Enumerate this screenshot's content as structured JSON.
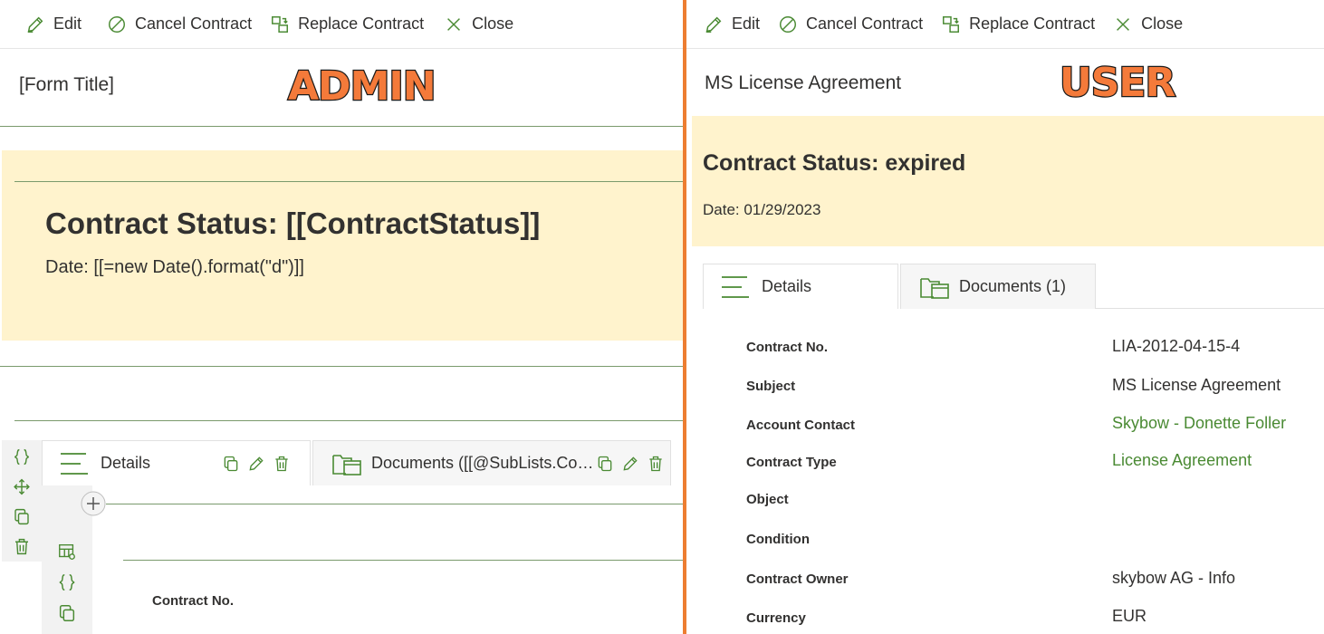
{
  "toolbar": {
    "edit_label": "Edit",
    "cancel_label": "Cancel Contract",
    "replace_label": "Replace Contract",
    "close_label": "Close"
  },
  "admin": {
    "badge": "ADMIN",
    "form_title": "[Form Title]",
    "status_title": "Contract Status: [[ContractStatus]]",
    "status_date": "Date: [[=new Date().format(\"d\")]]",
    "tabs": [
      {
        "label": "Details"
      },
      {
        "label": "Documents ([[@SubLists.Contract Documents]])"
      }
    ],
    "field_label": "Contract No."
  },
  "user": {
    "badge": "USER",
    "form_title": "MS License Agreement",
    "status_title": "Contract Status: expired",
    "status_date": "Date: 01/29/2023",
    "tabs": [
      {
        "label": "Details"
      },
      {
        "label": "Documents (1)"
      }
    ],
    "fields": [
      {
        "label": "Contract No.",
        "value": "LIA-2012-04-15-4",
        "link": false
      },
      {
        "label": "Subject",
        "value": "MS License Agreement",
        "link": false
      },
      {
        "label": "Account Contact",
        "value": "Skybow - Donette Foller",
        "link": true
      },
      {
        "label": "Contract Type",
        "value": "License Agreement",
        "link": true
      },
      {
        "label": "Object",
        "value": "",
        "link": false
      },
      {
        "label": "Condition",
        "value": "",
        "link": false
      },
      {
        "label": "Contract Owner",
        "value": "skybow AG - Info",
        "link": false
      },
      {
        "label": "Currency",
        "value": "EUR",
        "link": false
      }
    ]
  },
  "colors": {
    "accent_green": "#4a8a33",
    "status_background": "#fff3cd",
    "divider_orange": "#ed7d31",
    "badge_orange": "#f47a3a"
  },
  "icons": [
    "edit-icon",
    "cancel-icon",
    "replace-icon",
    "close-icon",
    "details-lines-icon",
    "documents-folder-icon",
    "braces-icon",
    "move-icon",
    "copy-icon",
    "trash-icon",
    "add-icon",
    "table-settings-icon"
  ]
}
